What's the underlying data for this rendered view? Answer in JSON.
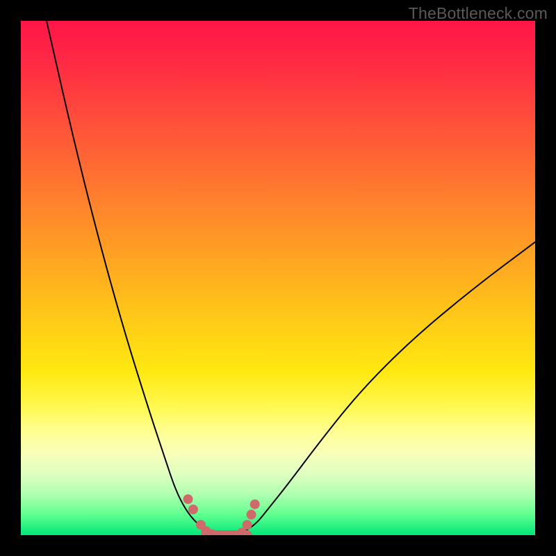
{
  "watermark": "TheBottleneck.com",
  "chart_data": {
    "type": "line",
    "title": "",
    "xlabel": "",
    "ylabel": "",
    "xlim": [
      0,
      100
    ],
    "ylim": [
      0,
      100
    ],
    "series": [
      {
        "name": "left-curve",
        "x": [
          5,
          10,
          15,
          20,
          25,
          28,
          30,
          32,
          34,
          36,
          38
        ],
        "values": [
          100,
          78,
          58,
          40,
          24,
          15,
          9,
          5,
          2.5,
          1,
          0
        ]
      },
      {
        "name": "right-curve",
        "x": [
          42,
          44,
          46,
          48,
          52,
          58,
          66,
          76,
          88,
          100
        ],
        "values": [
          0,
          1,
          2.5,
          5,
          10,
          18,
          28,
          38,
          48,
          57
        ]
      },
      {
        "name": "bottom-band",
        "x": [
          36,
          37,
          38,
          39,
          40,
          41,
          42,
          43,
          44
        ],
        "values": [
          0,
          0,
          0,
          0,
          0,
          0,
          0,
          0,
          0
        ]
      }
    ],
    "markers": {
      "left_dots": [
        {
          "x": 32.5,
          "y": 7
        },
        {
          "x": 33.5,
          "y": 5
        },
        {
          "x": 35,
          "y": 2
        },
        {
          "x": 36,
          "y": 0.8
        },
        {
          "x": 37.2,
          "y": 0.2
        },
        {
          "x": 38.5,
          "y": 0
        },
        {
          "x": 40,
          "y": 0
        },
        {
          "x": 41.5,
          "y": 0
        }
      ],
      "right_dots": [
        {
          "x": 43,
          "y": 0.5
        },
        {
          "x": 44,
          "y": 2
        },
        {
          "x": 44.8,
          "y": 4
        },
        {
          "x": 45.5,
          "y": 6
        }
      ]
    },
    "colors": {
      "curve": "#000000",
      "marker_fill": "#cf6a6a",
      "marker_stroke": "#cf6a6a"
    }
  }
}
